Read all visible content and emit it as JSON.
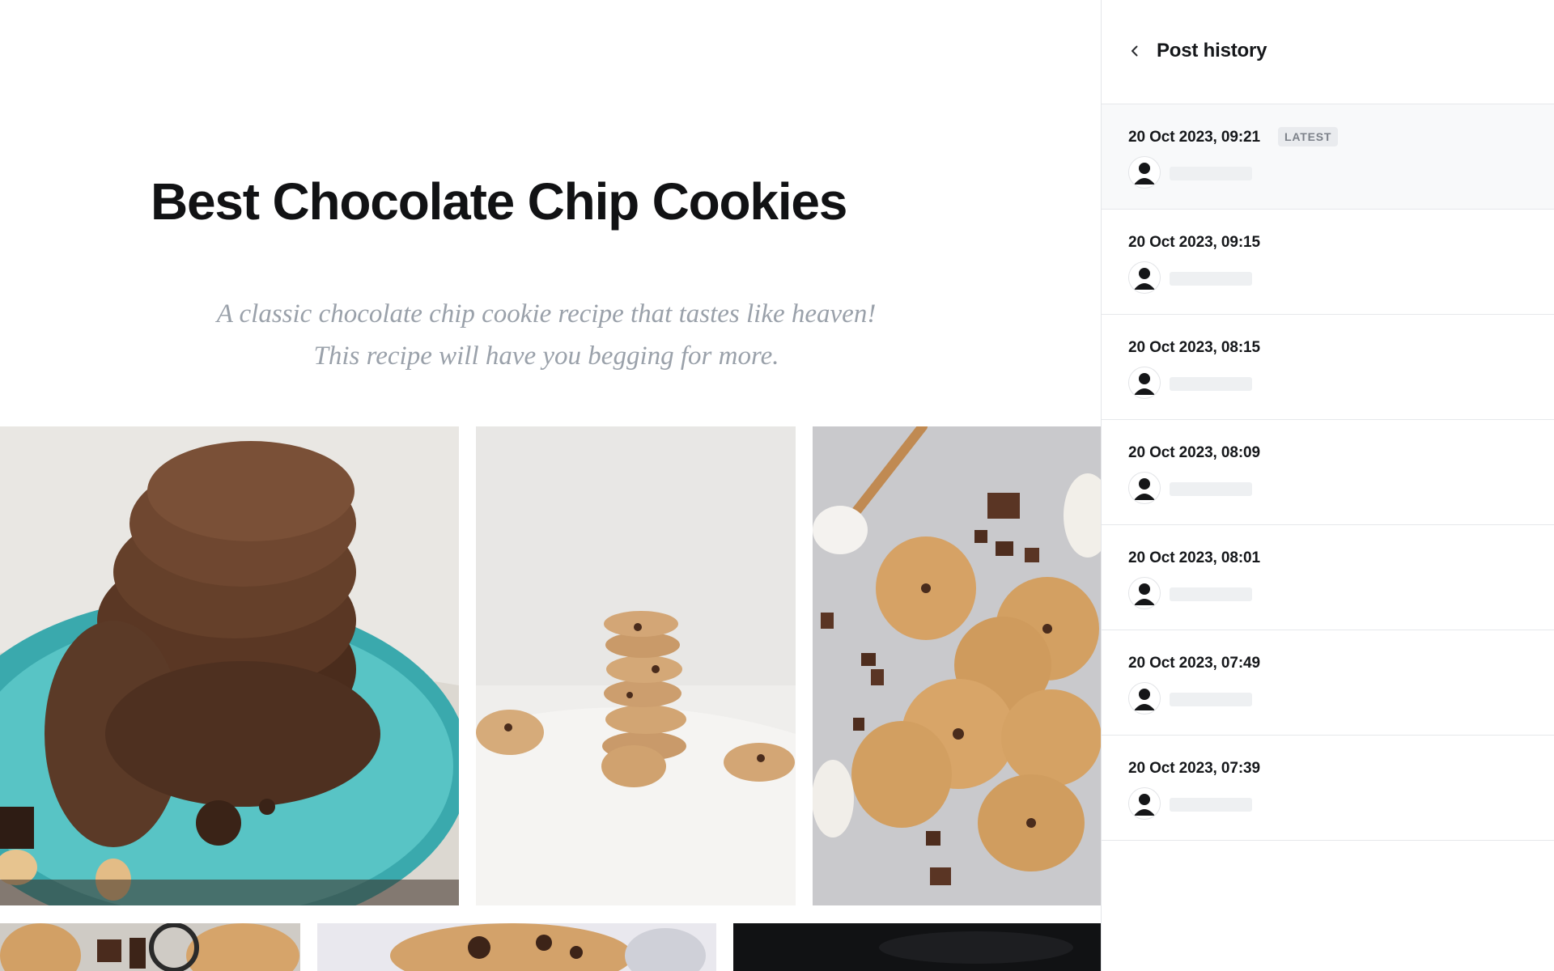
{
  "post": {
    "title": "Best Chocolate Chip Cookies",
    "excerpt": "A classic chocolate chip cookie recipe that tastes like heaven! This recipe will have you begging for more."
  },
  "gallery": {
    "photos": [
      {
        "name": "photo-1",
        "subject": "stacked chocolate cookies on turquoise plate"
      },
      {
        "name": "photo-2",
        "subject": "stack of chocolate chip cookies on white cloth"
      },
      {
        "name": "photo-3",
        "subject": "chocolate chip cookies with chocolate chunks and wooden spoon"
      },
      {
        "name": "photo-4",
        "subject": "cookies with chocolate pieces"
      },
      {
        "name": "photo-5",
        "subject": "broken chocolate chip cookies"
      },
      {
        "name": "photo-6",
        "subject": "dark background"
      }
    ]
  },
  "panel": {
    "title": "Post history",
    "back_icon": "chevron-left-icon",
    "revisions": [
      {
        "date": "20 Oct 2023, 09:21",
        "badge": "LATEST",
        "latest": true
      },
      {
        "date": "20 Oct 2023, 09:15"
      },
      {
        "date": "20 Oct 2023, 08:15"
      },
      {
        "date": "20 Oct 2023, 08:09"
      },
      {
        "date": "20 Oct 2023, 08:01"
      },
      {
        "date": "20 Oct 2023, 07:49"
      },
      {
        "date": "20 Oct 2023, 07:39"
      }
    ]
  },
  "colors": {
    "title_text": "#111214",
    "excerpt_text": "#9aa1aa",
    "latest_row_bg": "#f8f9fa",
    "badge_bg": "#e9ebee",
    "badge_text": "#7c8189",
    "divider": "#e6e8eb"
  }
}
